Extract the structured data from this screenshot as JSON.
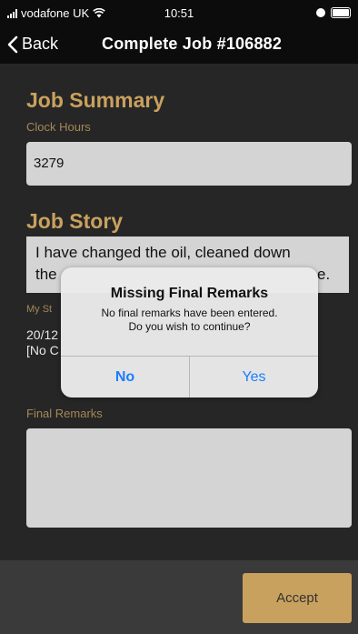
{
  "status": {
    "carrier": "vodafone UK",
    "time": "10:51"
  },
  "nav": {
    "back_label": "Back",
    "title": "Complete Job #106882"
  },
  "job_summary": {
    "heading": "Job Summary",
    "clock_hours_label": "Clock Hours",
    "clock_hours_value": "3279"
  },
  "job_story": {
    "heading": "Job Story",
    "line1": "I have changed the oil, cleaned down",
    "line2_left": "the",
    "line2_right": "e.",
    "my_story_label": "My St",
    "my_story_line1": "20/12",
    "my_story_line2": "[No C"
  },
  "final_remarks": {
    "label": "Final Remarks",
    "value": ""
  },
  "footer": {
    "accept_label": "Accept"
  },
  "alert": {
    "title": "Missing Final Remarks",
    "message_line1": "No final remarks have been entered.",
    "message_line2": "Do you wish to continue?",
    "no_label": "No",
    "yes_label": "Yes"
  },
  "colors": {
    "accent_gold": "#c9a15e",
    "ios_blue": "#1a7dff",
    "background": "#262626"
  }
}
